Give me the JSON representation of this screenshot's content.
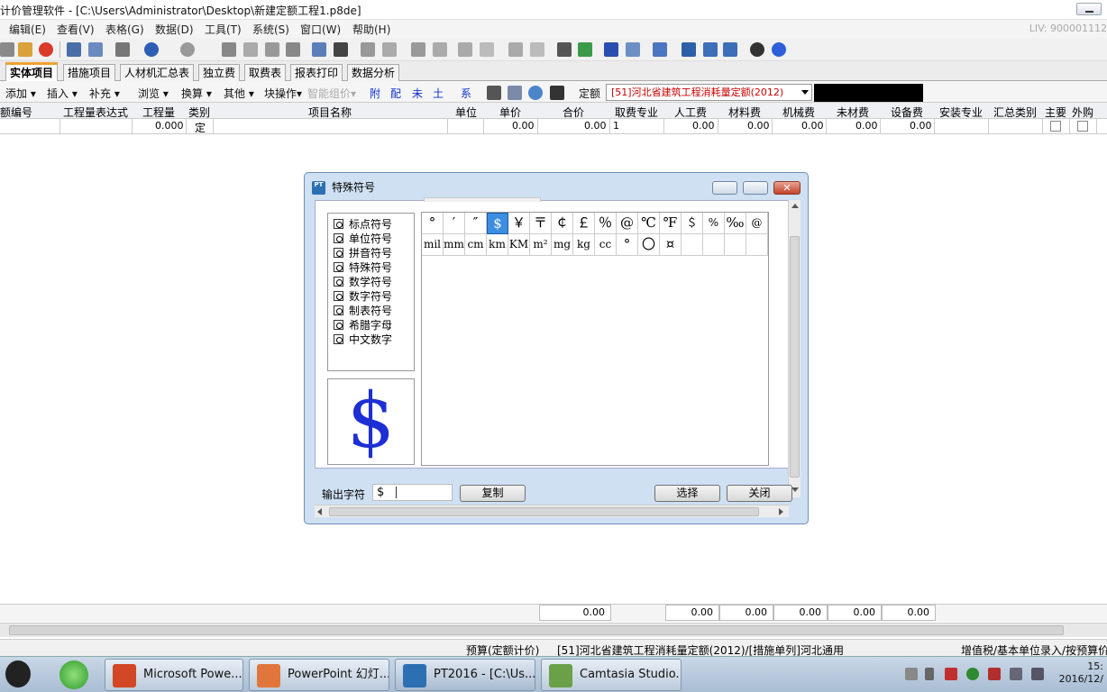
{
  "window": {
    "title": "计价管理软件 - [C:\\Users\\Administrator\\Desktop\\新建定额工程1.p8de]"
  },
  "menu": {
    "items": [
      "编辑(E)",
      "查看(V)",
      "表格(G)",
      "数据(D)",
      "工具(T)",
      "系统(S)",
      "窗口(W)",
      "帮助(H)"
    ],
    "license": "LIV: 900001112"
  },
  "toolbar": {
    "icons": [
      "new-icon",
      "open-icon",
      "add-icon",
      "document-icon",
      "notes-icon",
      "print-icon",
      "undo-icon",
      "redo-icon",
      "cut-icon",
      "copy-icon",
      "paste-icon",
      "delete-icon",
      "insert-icon",
      "edit-icon",
      "move-right-icon",
      "move-left-icon",
      "up-icon",
      "down-icon",
      "binoculars-icon",
      "refresh-icon",
      "star-icon",
      "calculator-icon",
      "chart-icon",
      "window-icon",
      "split-icon",
      "layout-icon",
      "qq-icon",
      "help-icon"
    ]
  },
  "tabs": [
    "实体项目",
    "措施项目",
    "人材机汇总表",
    "独立费",
    "取费表",
    "报表打印",
    "数据分析"
  ],
  "subtoolbar": {
    "items": [
      "添加",
      "插入",
      "补充",
      "浏览",
      "换算",
      "其他",
      "块操作",
      "智能组价"
    ],
    "letters": [
      "附",
      "配",
      "未",
      "土",
      "系"
    ],
    "quota_label": "定额",
    "quota_value": "[51]河北省建筑工程消耗量定额(2012)"
  },
  "grid": {
    "columns": [
      "额编号",
      "工程量表达式",
      "工程量",
      "类别",
      "项目名称",
      "单位",
      "单价",
      "合价",
      "取费专业",
      "人工费",
      "材料费",
      "机械费",
      "未材费",
      "设备费",
      "安装专业",
      "汇总类别",
      "主要",
      "外购"
    ],
    "row": {
      "quantity": "0.000",
      "type": "定",
      "unit_price": "0.00",
      "total": "0.00",
      "fee_major": "1",
      "labor": "0.00",
      "material": "0.00",
      "machine": "0.00",
      "unpriced": "0.00",
      "equipment": "0.00"
    }
  },
  "summary": [
    "0.00",
    "0.00",
    "0.00",
    "0.00",
    "0.00",
    "0.00"
  ],
  "status": {
    "mode": "预算(定额计价)",
    "quota": "[51]河北省建筑工程消耗量定额(2012)/[措施单列]河北通用",
    "tax": "增值税/基本单位录入/按预算价"
  },
  "taskbar": {
    "tasks": [
      "Microsoft Powe...",
      "PowerPoint 幻灯...",
      "PT2016 - [C:\\Us...",
      "Camtasia Studio..."
    ],
    "clock_time": "15:",
    "clock_date": "2016/12/"
  },
  "dialog": {
    "title": "特殊符号",
    "categories": [
      "标点符号",
      "单位符号",
      "拼音符号",
      "特殊符号",
      "数学符号",
      "数字符号",
      "制表符号",
      "希腊字母",
      "中文数字"
    ],
    "symbols_row1": [
      "°",
      "′",
      "″",
      "$",
      "￥",
      "〒",
      "￠",
      "￡",
      "％",
      "@",
      "℃",
      "℉",
      "＄",
      "%",
      "‰",
      "@"
    ],
    "symbols_row2": [
      "mil",
      "mm",
      "cm",
      "km",
      "KM",
      "m²",
      "mg",
      "kg",
      "cc",
      "°",
      "〇",
      "¤",
      "",
      "",
      "",
      ""
    ],
    "selected_symbol": "$",
    "preview": "$",
    "output_label": "输出字符",
    "output_value": "$",
    "copy_label": "复制",
    "select_label": "选择",
    "close_label": "关闭",
    "icon_text": "PT"
  }
}
